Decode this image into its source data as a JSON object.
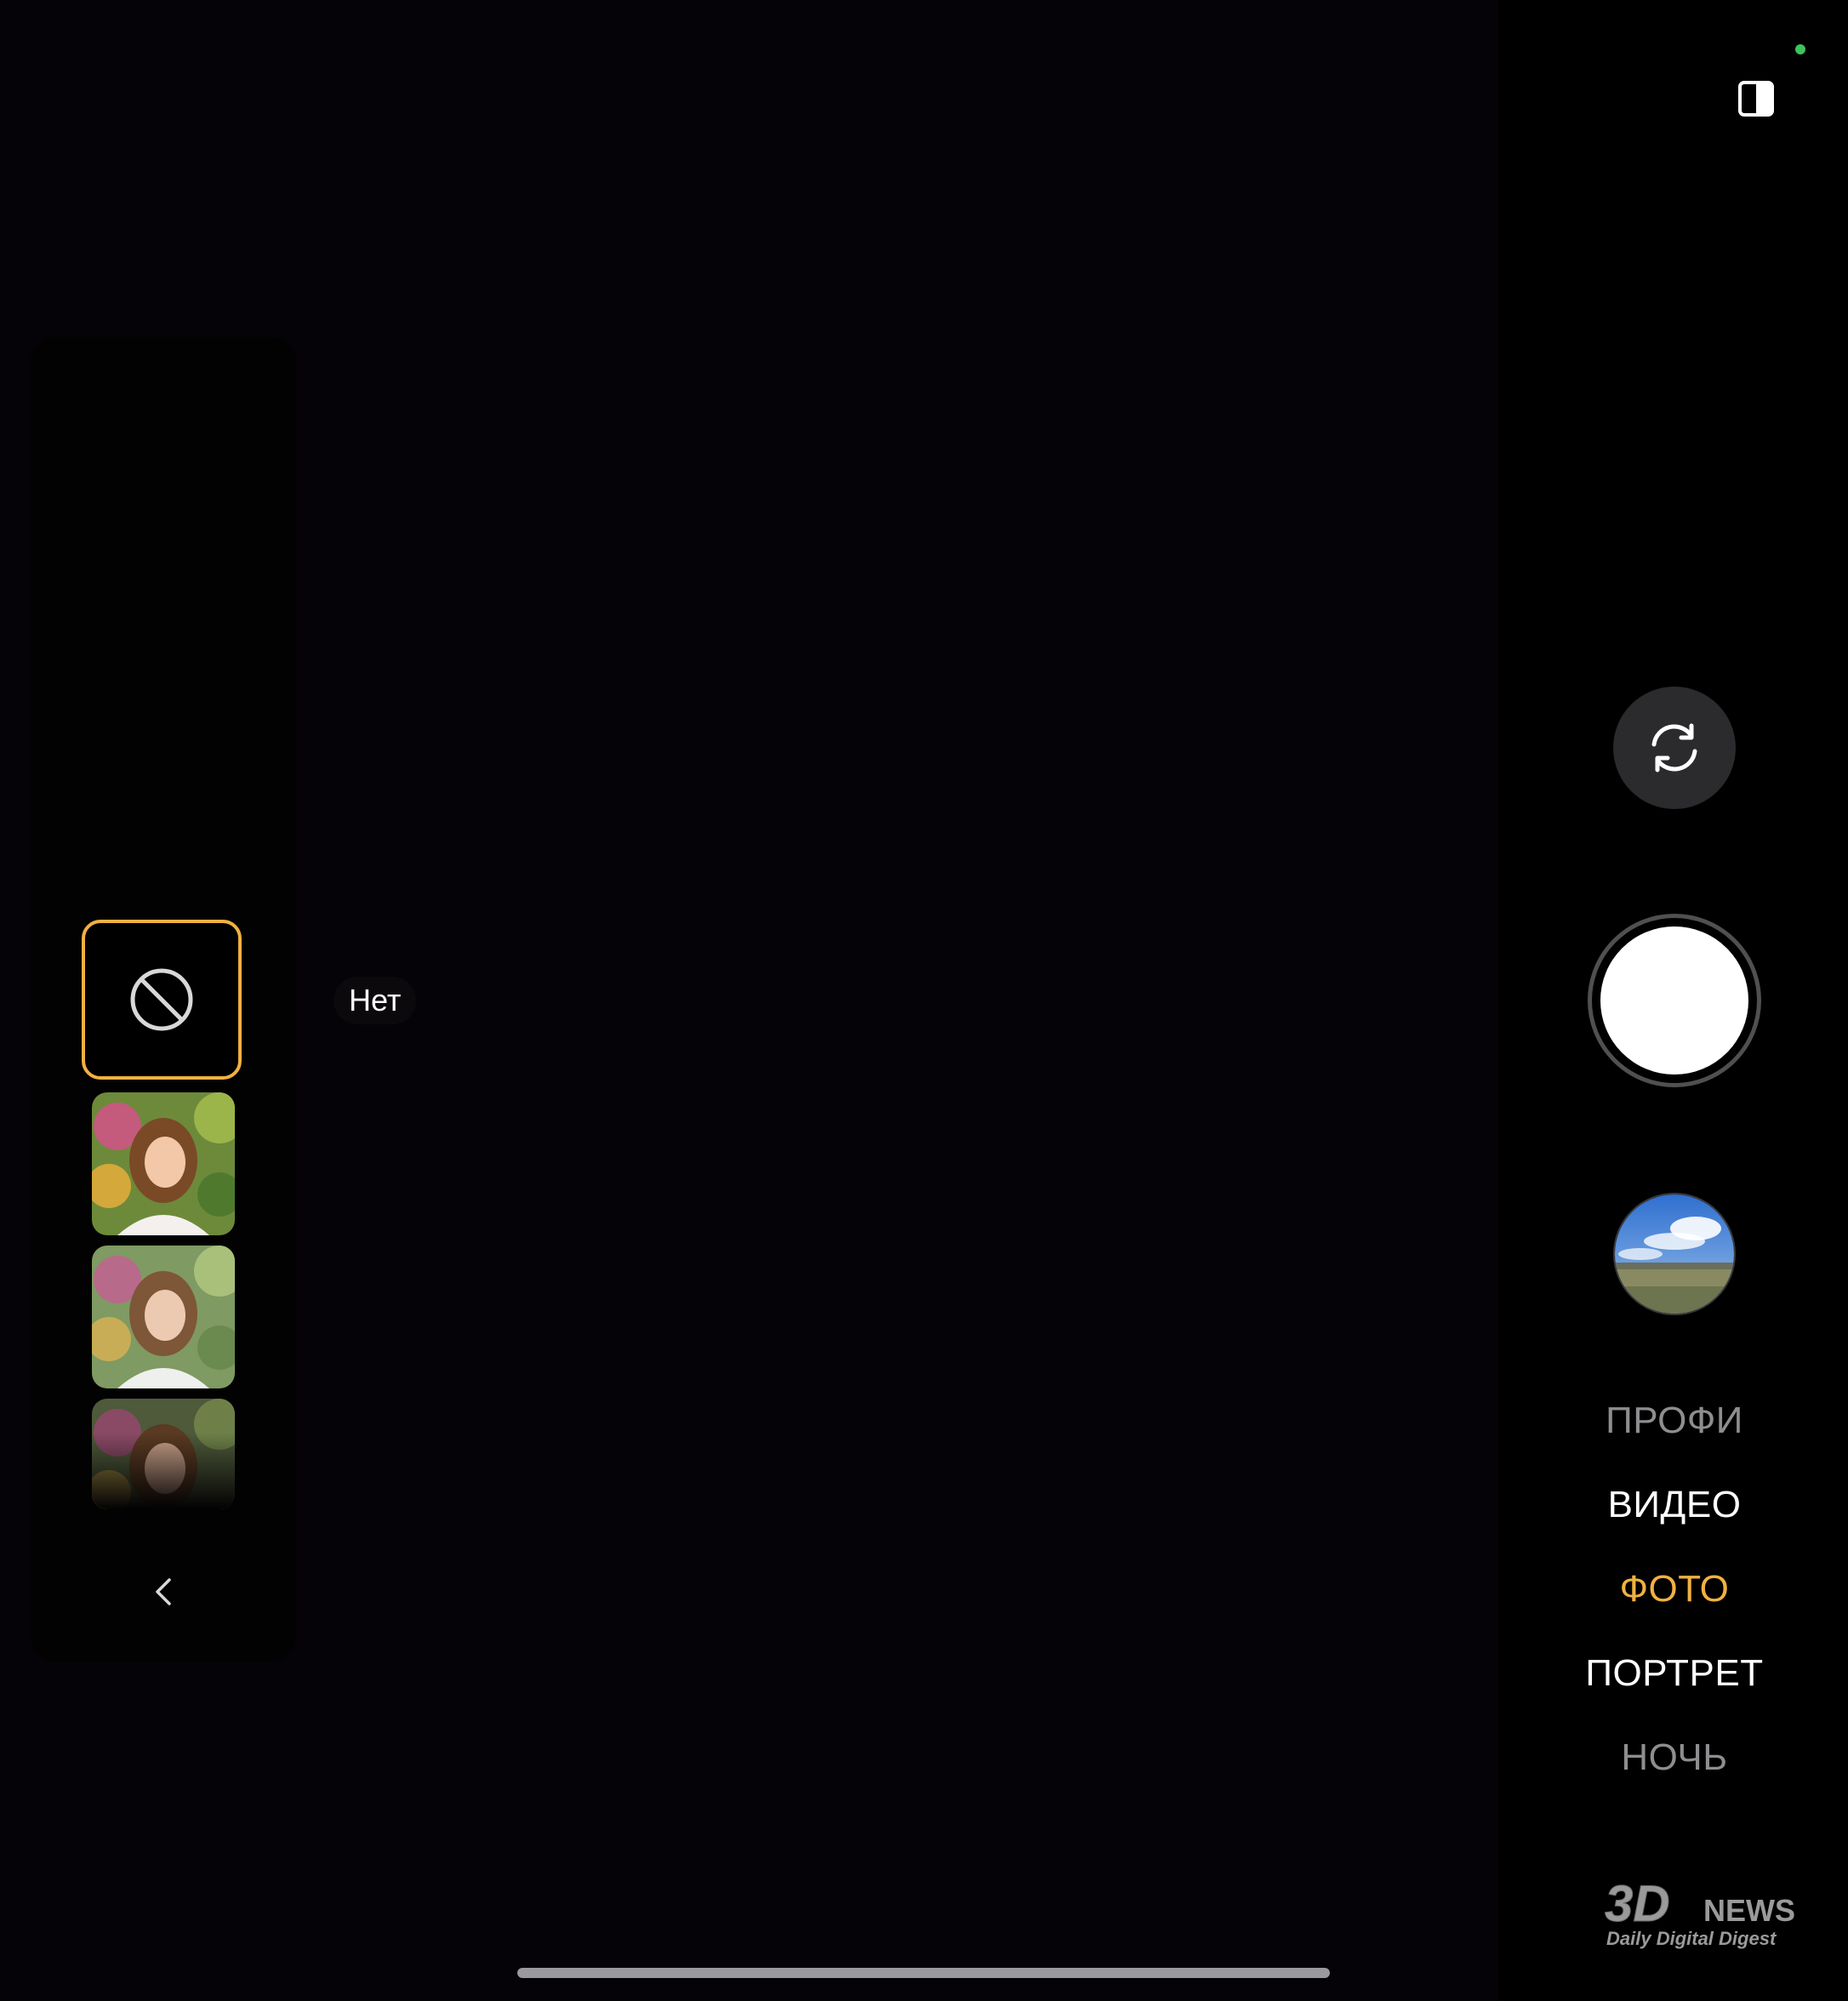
{
  "filters": {
    "selected_label": "Нет",
    "items": [
      {
        "name": "none",
        "icon": "no-filter-icon"
      },
      {
        "name": "portrait-1",
        "icon": "portrait-thumbnail"
      },
      {
        "name": "portrait-2",
        "icon": "portrait-thumbnail"
      },
      {
        "name": "portrait-3",
        "icon": "portrait-thumbnail"
      }
    ],
    "collapse_icon": "chevron-left-icon"
  },
  "controls": {
    "layout_icon": "split-view-icon",
    "switch_camera_icon": "switch-camera-icon",
    "shutter_icon": "shutter-button",
    "gallery_icon": "gallery-thumbnail"
  },
  "modes": [
    {
      "label": "ПРОФИ"
    },
    {
      "label": "ВИДЕО"
    },
    {
      "label": "ФОТО"
    },
    {
      "label": "ПОРТРЕТ"
    },
    {
      "label": "НОЧЬ"
    }
  ],
  "watermark": {
    "logo": "3D",
    "word": "NEWS",
    "tagline": "Daily Digital Digest"
  },
  "colors": {
    "accent": "#f1b141",
    "status_dot": "#3ec25a",
    "viewfinder": "#050307",
    "control_button": "#2b2a2d"
  }
}
